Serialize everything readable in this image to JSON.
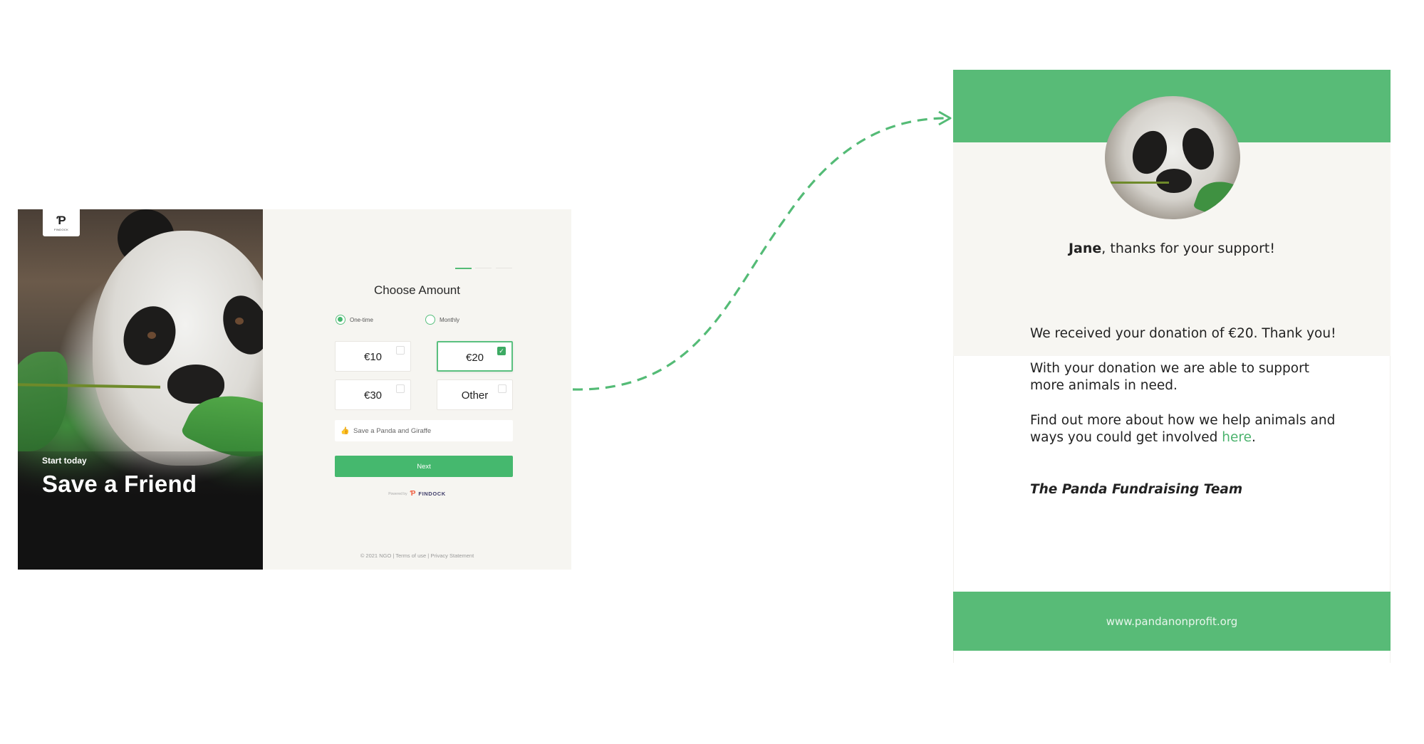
{
  "colors": {
    "brand_green": "#58bb77",
    "button_green": "#45b86e",
    "panel_beige": "#f6f5f1",
    "text_dark": "#222222",
    "findock_orange": "#f05a3c",
    "findock_navy": "#3f3d6a"
  },
  "form_page": {
    "logo": {
      "icon": "findock-logo-icon",
      "label": "FINDOCK"
    },
    "hero": {
      "subtitle": "Start today",
      "title": "Save a Friend"
    },
    "progress": {
      "steps_total": 3,
      "current_step": 1
    },
    "title": "Choose Amount",
    "frequency": {
      "options": [
        {
          "label": "One-time",
          "selected": true
        },
        {
          "label": "Monthly",
          "selected": false
        }
      ]
    },
    "amounts": [
      {
        "label": "€10",
        "selected": false
      },
      {
        "label": "€20",
        "selected": true
      },
      {
        "label": "€30",
        "selected": false
      },
      {
        "label": "Other",
        "selected": false
      }
    ],
    "campaign": {
      "icon": "thumbs-up-icon",
      "value": "Save a Panda and Giraffe"
    },
    "next_label": "Next",
    "powered_by": {
      "prefix": "Powered by",
      "brand": "FINDOCK"
    },
    "footer": {
      "copyright": "© 2021 NGO",
      "separator": " | ",
      "terms": "Terms of use",
      "privacy": "Privacy Statement"
    }
  },
  "connector": {
    "style": "dashed-arrow",
    "direction": "form-to-email"
  },
  "email": {
    "greeting_name": "Jane",
    "greeting_rest": ", thanks for your support!",
    "paragraphs": {
      "p1": "We received your donation of €20. Thank you!",
      "p2": "With your donation we are able to support more animals in need.",
      "p3_text": "Find out more about how we help animals and ways you could get involved ",
      "p3_link": "here",
      "p3_end": "."
    },
    "signoff": "The Panda Fundraising Team",
    "footer_url": "www.pandanonprofit.org"
  }
}
